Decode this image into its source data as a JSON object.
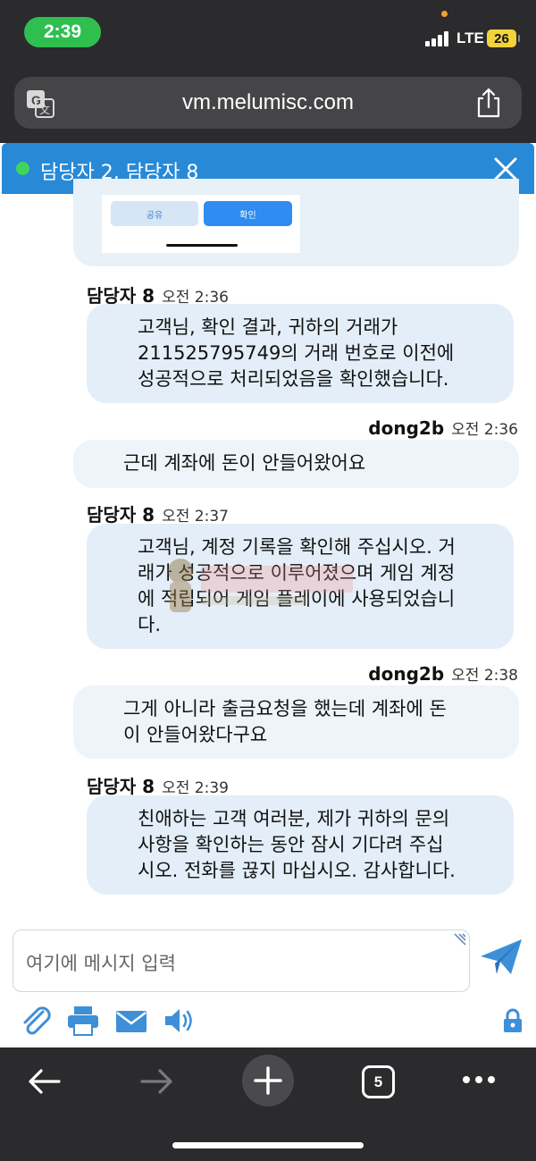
{
  "status_bar": {
    "time": "2:39",
    "network": "LTE",
    "battery": "26"
  },
  "browser": {
    "url": "vm.melumisc.com",
    "tab_count": "5"
  },
  "chat": {
    "header_title": "담당자 2, 담당자 8",
    "previous_card": {
      "share_label": "공유",
      "confirm_label": "확인"
    },
    "messages": [
      {
        "sender": "담당자 8",
        "time": "오전 2:36",
        "side": "agent",
        "lines": [
          "고객님, 확인 결과, 귀하의 거래가",
          "211525795749의 거래 번호로 이전에",
          "성공적으로 처리되었음을 확인했습니다."
        ]
      },
      {
        "sender": "dong2b",
        "time": "오전 2:36",
        "side": "user",
        "lines": [
          "근데 계좌에 돈이 안들어왔어요"
        ]
      },
      {
        "sender": "담당자 8",
        "time": "오전 2:37",
        "side": "agent",
        "lines": [
          "고객님, 계정 기록을 확인해 주십시오. 거",
          "래가 성공적으로 이루어졌으며 게임 계정",
          "에 적립되어 게임 플레이에 사용되었습니",
          "다."
        ]
      },
      {
        "sender": "dong2b",
        "time": "오전 2:38",
        "side": "user",
        "lines": [
          "그게 아니라 출금요청을 했는데 계좌에 돈",
          "이 안들어왔다구요"
        ]
      },
      {
        "sender": "담당자 8",
        "time": "오전 2:39",
        "side": "agent",
        "lines": [
          "친애하는 고객 여러분, 제가 귀하의 문의",
          "사항을 확인하는 동안 잠시 기다려 주십",
          "시오. 전화를 끊지 마십시오. 감사합니다."
        ]
      }
    ],
    "composer_placeholder": "여기에 메시지 입력"
  },
  "colors": {
    "header": "#2889d6",
    "bubble": "#e3eef8",
    "online": "#3fd45d",
    "send": "#3d8fd8"
  }
}
